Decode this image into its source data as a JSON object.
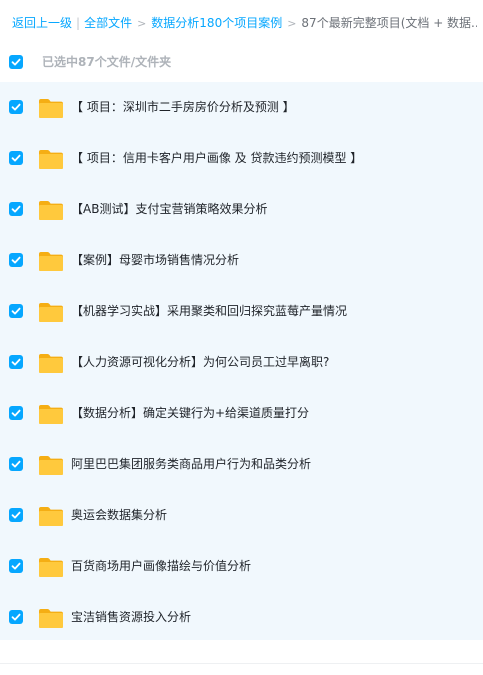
{
  "breadcrumb": {
    "back": "返回上一级",
    "all_files": "全部文件",
    "parent": "数据分析180个项目案例",
    "current": "87个最新完整项目(文档 + 数据..."
  },
  "selection": {
    "label": "已选中87个文件/文件夹",
    "checked": true
  },
  "files": [
    {
      "name": "【 项目：深圳市二手房房价分析及预测 】",
      "type": "folder",
      "checked": true
    },
    {
      "name": "【 项目：信用卡客户用户画像 及 贷款违约预测模型 】",
      "type": "folder",
      "checked": true
    },
    {
      "name": "【AB测试】支付宝营销策略效果分析",
      "type": "folder",
      "checked": true
    },
    {
      "name": "【案例】母婴市场销售情况分析",
      "type": "folder",
      "checked": true
    },
    {
      "name": "【机器学习实战】采用聚类和回归探究蓝莓产量情况",
      "type": "folder",
      "checked": true
    },
    {
      "name": "【人力资源可视化分析】为何公司员工过早离职?",
      "type": "folder",
      "checked": true
    },
    {
      "name": "【数据分析】确定关键行为+给渠道质量打分",
      "type": "folder",
      "checked": true
    },
    {
      "name": "阿里巴巴集团服务类商品用户行为和品类分析",
      "type": "folder",
      "checked": true
    },
    {
      "name": "奥运会数据集分析",
      "type": "folder",
      "checked": true
    },
    {
      "name": "百货商场用户画像描绘与价值分析",
      "type": "folder",
      "checked": true
    },
    {
      "name": "宝洁销售资源投入分析",
      "type": "folder",
      "checked": true
    }
  ],
  "colors": {
    "accent": "#06a7ff",
    "list_background": "#f1f8fd",
    "folder": "#ffc93d"
  },
  "icons": {
    "checkbox": "checkmark-icon",
    "folder": "folder-icon"
  }
}
